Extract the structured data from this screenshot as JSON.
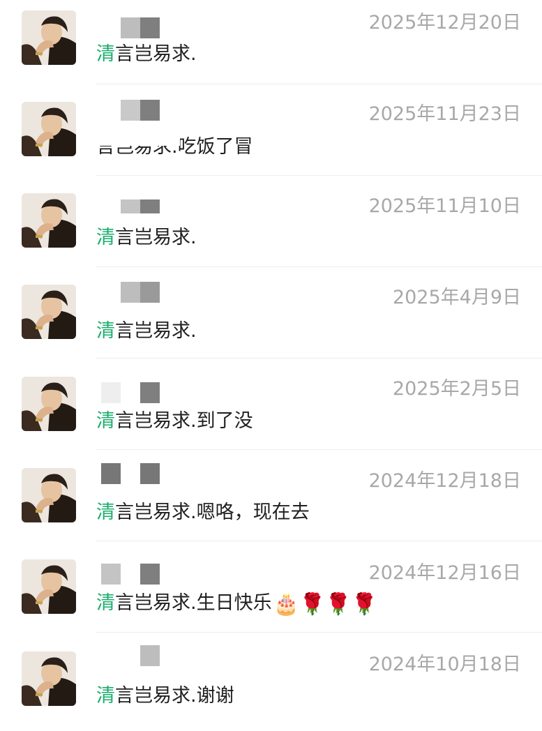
{
  "colors": {
    "green_prefix": "#1aad6c",
    "date_gray": "#a8a8a8",
    "message_text": "#1f1f1f",
    "divider": "#ededed"
  },
  "rows": [
    {
      "date": "2025年12月20日",
      "prefix": "清",
      "message": "言岂易求.",
      "emoji": ""
    },
    {
      "date": "2025年11月23日",
      "prefix": "",
      "message": "言岂易求.吃饭了冒",
      "emoji": ""
    },
    {
      "date": "2025年11月10日",
      "prefix": "清",
      "message": "言岂易求.",
      "emoji": ""
    },
    {
      "date": "2025年4月9日",
      "prefix": "清",
      "message": "言岂易求.",
      "emoji": ""
    },
    {
      "date": "2025年2月5日",
      "prefix": "清",
      "message": "言岂易求.到了没",
      "emoji": ""
    },
    {
      "date": "2024年12月18日",
      "prefix": "清",
      "message": "言岂易求.嗯咯，现在去",
      "emoji": ""
    },
    {
      "date": "2024年12月16日",
      "prefix": "清",
      "message": "言岂易求.生日快乐",
      "emoji": "🎂🌹🌹🌹"
    },
    {
      "date": "2024年10月18日",
      "prefix": "清",
      "message": "言岂易求.谢谢",
      "emoji": ""
    }
  ],
  "icons": {
    "avatar": "avatar-illustration-icon",
    "cake": "birthday-cake-icon",
    "rose": "rose-icon"
  }
}
